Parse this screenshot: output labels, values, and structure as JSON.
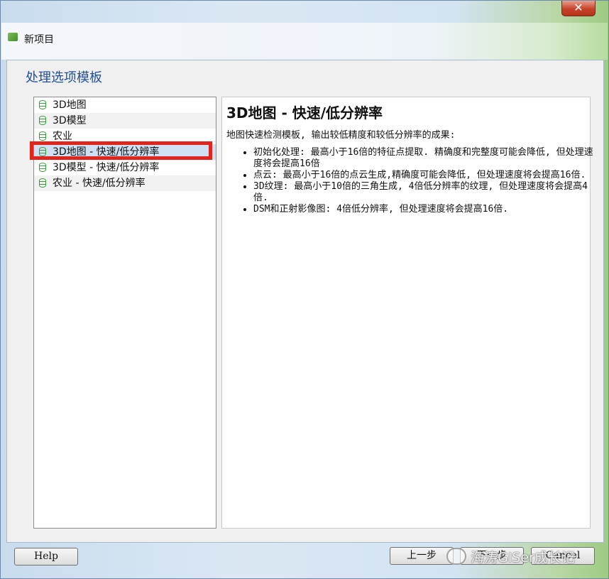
{
  "window": {
    "close_glyph": "✕"
  },
  "tab": {
    "label": "新项目",
    "icon": "pix4d-app-icon"
  },
  "page": {
    "title": "处理选项模板"
  },
  "templates": [
    {
      "label": "3D地图",
      "icon": "database-icon"
    },
    {
      "label": "3D模型",
      "icon": "database-icon"
    },
    {
      "label": "农业",
      "icon": "database-icon"
    },
    {
      "label": "3D地图 - 快速/低分辨率",
      "icon": "database-icon",
      "selected": true
    },
    {
      "label": "3D模型 - 快速/低分辨率",
      "icon": "database-icon"
    },
    {
      "label": "农业 - 快速/低分辨率",
      "icon": "database-icon"
    }
  ],
  "detail": {
    "title": "3D地图 - 快速/低分辨率",
    "description": "地图快速检测模板, 输出较低精度和较低分辨率的成果:",
    "bullets": [
      "初始化处理: 最高小于16倍的特征点提取. 精确度和完整度可能会降低, 但处理速度将会提高16倍",
      "点云: 最高小于16倍的点云生成,精确度可能会降低, 但处理速度将会提高16倍.",
      "3D纹理: 最高小于10倍的三角生成, 4倍低分辨率的纹理, 但处理速度将会提高4倍.",
      "DSM和正射影像图: 4倍低分辨率, 但处理速度将会提高16倍."
    ]
  },
  "footer": {
    "help_label": "Help",
    "prev_label": "上一步",
    "next_label": "下一步",
    "cancel_label": "Cancel"
  },
  "watermark": {
    "text": "海涛GISer成长记"
  },
  "colors": {
    "highlight": "#e0241e",
    "title_blue": "#1f4f9a",
    "selected_bg": "#cfe0f3"
  }
}
